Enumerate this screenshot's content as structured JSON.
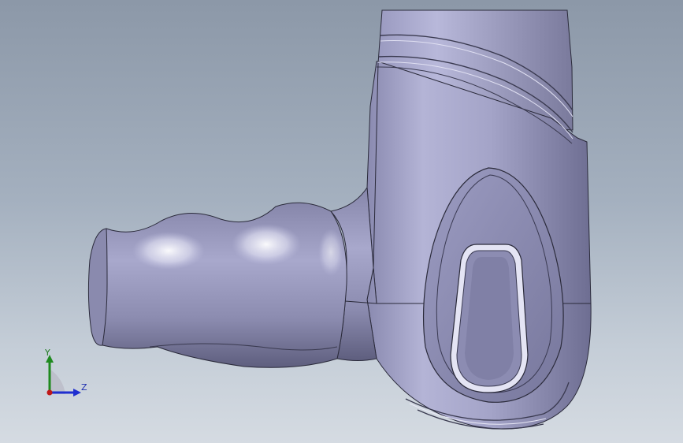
{
  "viewport": {
    "background_top": "#8c98a8",
    "background_bottom": "#d5dbe2"
  },
  "model": {
    "body_color": "#8f8fb4",
    "edge_color": "#2a2a3a"
  },
  "triad": {
    "y_label": "Y",
    "z_label": "Z",
    "y_color": "#1f7a1f",
    "z_color": "#1f2fb0",
    "origin_color": "#c01818"
  }
}
